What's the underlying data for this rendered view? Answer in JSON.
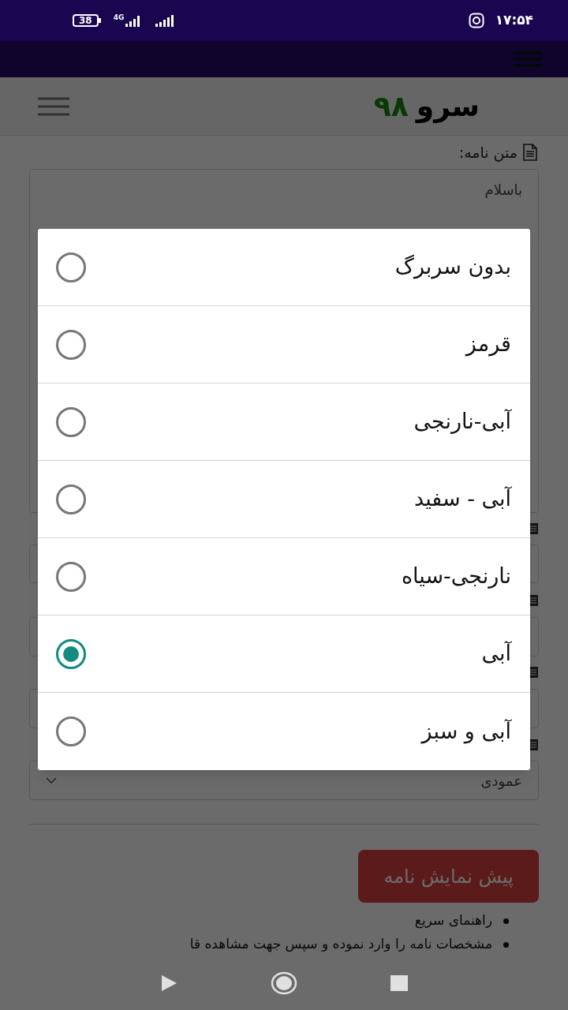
{
  "status_bar": {
    "time": "۱۷:۵۴",
    "network": "4G",
    "battery": "38"
  },
  "header": {
    "brand_name": "سرو",
    "brand_number": "۹۸"
  },
  "form": {
    "letter_label": "متن نامه:",
    "letter_text": "باسلام",
    "layout_select": "عمودی",
    "preview_button": "پیش نمایش نامه",
    "help_items": [
      "راهنمای سریع",
      "مشخصات نامه را وارد نموده و سپس جهت مشاهده قا"
    ]
  },
  "dialog": {
    "options": [
      {
        "label": "بدون سربرگ",
        "selected": false
      },
      {
        "label": "قرمز",
        "selected": false
      },
      {
        "label": "آبی-نارنجی",
        "selected": false
      },
      {
        "label": "آبی - سفید",
        "selected": false
      },
      {
        "label": "نارنجی-سیاه",
        "selected": false
      },
      {
        "label": "آبی",
        "selected": true
      },
      {
        "label": "آبی و سبز",
        "selected": false
      }
    ]
  }
}
